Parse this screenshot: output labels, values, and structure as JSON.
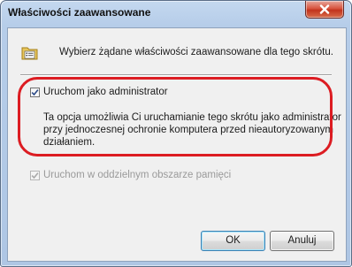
{
  "window": {
    "title": "Właściwości zaawansowane"
  },
  "header": {
    "icon": "properties-folder-icon",
    "text": "Wybierz żądane właściwości zaawansowane dla tego skrótu."
  },
  "options": {
    "run_as_admin": {
      "label": "Uruchom jako administrator",
      "checked": true,
      "enabled": true,
      "description_lines": [
        "Ta opcja umożliwia Ci uruchamianie tego skrótu jako administrator",
        "przy jednoczesnej ochronie komputera przed nieautoryzowanym",
        "działaniem."
      ]
    },
    "separate_memory": {
      "label": "Uruchom w oddzielnym obszarze pamięci",
      "checked": true,
      "enabled": false
    }
  },
  "buttons": {
    "ok": "OK",
    "cancel": "Anuluj"
  },
  "colors": {
    "highlight": "#dc1c22",
    "close_button": "#c2331c",
    "titlebar": "#b6cde9"
  }
}
